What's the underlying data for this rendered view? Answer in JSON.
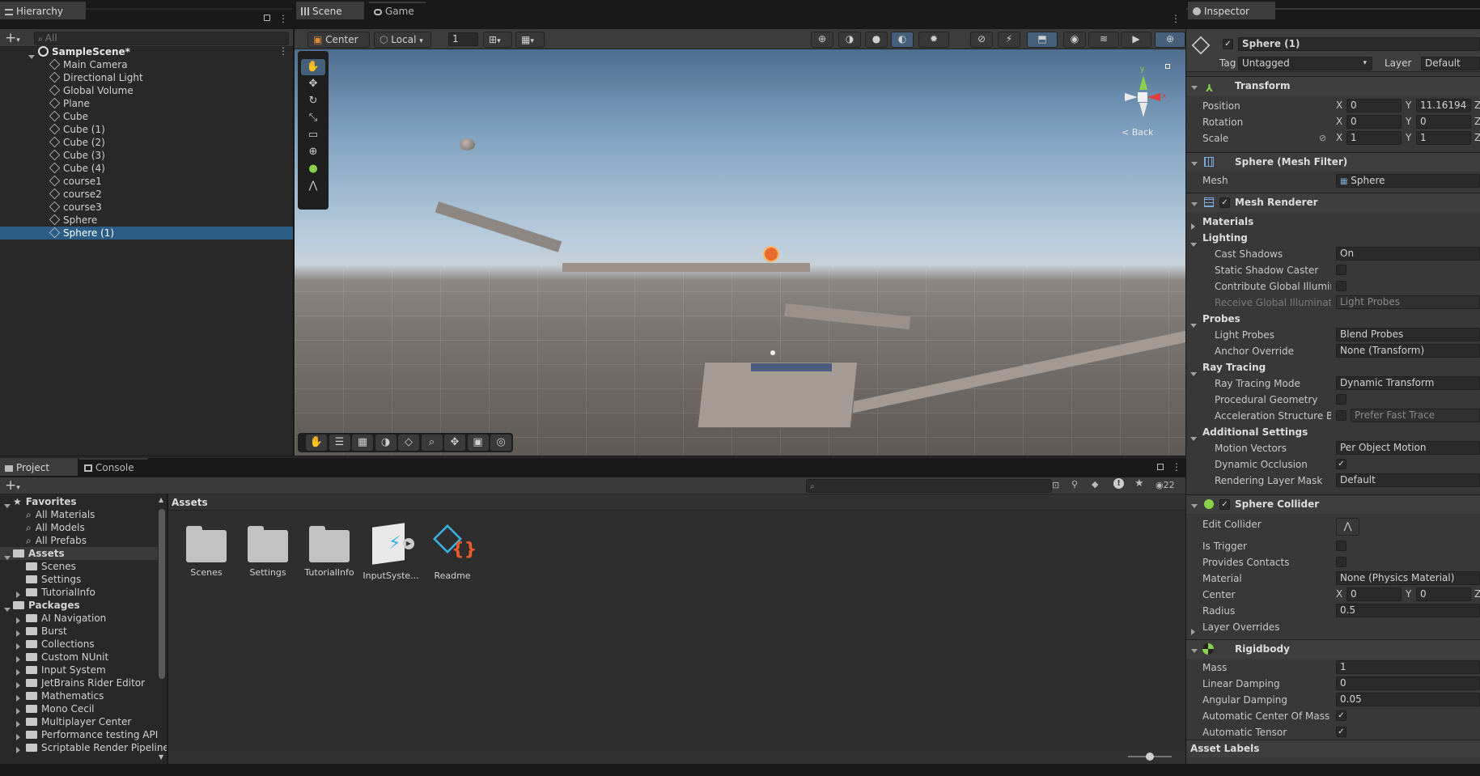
{
  "hierarchy": {
    "tab": "Hierarchy",
    "search_placeholder": "All",
    "scene_name": "SampleScene*",
    "items": [
      "Main Camera",
      "Directional Light",
      "Global Volume",
      "Plane",
      "Cube",
      "Cube (1)",
      "Cube (2)",
      "Cube (3)",
      "Cube (4)",
      "course1",
      "course2",
      "course3",
      "Sphere",
      "Sphere (1)"
    ],
    "selected": "Sphere (1)"
  },
  "scene": {
    "tabs": [
      "Scene",
      "Game"
    ],
    "pivot": "Center",
    "space": "Local",
    "grid_value": "1",
    "gizmo_back": "< Back"
  },
  "project": {
    "tabs": [
      "Project",
      "Console"
    ],
    "breadcrumb": "Assets",
    "hidden_count": "22",
    "favorites_label": "Favorites",
    "favorites": [
      "All Materials",
      "All Models",
      "All Prefabs"
    ],
    "assets_label": "Assets",
    "asset_folders": [
      "Scenes",
      "Settings",
      "TutorialInfo"
    ],
    "packages_label": "Packages",
    "packages": [
      "AI Navigation",
      "Burst",
      "Collections",
      "Custom NUnit",
      "Input System",
      "JetBrains Rider Editor",
      "Mathematics",
      "Mono Cecil",
      "Multiplayer Center",
      "Performance testing API",
      "Scriptable Render Pipeline"
    ],
    "tiles": [
      "Scenes",
      "Settings",
      "TutorialInfo",
      "InputSyste...",
      "Readme"
    ]
  },
  "inspector": {
    "tab": "Inspector",
    "object_name": "Sphere (1)",
    "tag_label": "Tag",
    "tag_value": "Untagged",
    "layer_label": "Layer",
    "layer_value": "Default",
    "transform": {
      "title": "Transform",
      "position_label": "Position",
      "pos_x": "0",
      "pos_y": "11.16194",
      "rotation_label": "Rotation",
      "rot_x": "0",
      "rot_y": "0",
      "scale_label": "Scale",
      "scale_x": "1",
      "scale_y": "1"
    },
    "mesh_filter": {
      "title": "Sphere (Mesh Filter)",
      "mesh_label": "Mesh",
      "mesh_value": "Sphere"
    },
    "mesh_renderer": {
      "title": "Mesh Renderer",
      "materials": "Materials",
      "lighting": "Lighting",
      "cast_shadows_label": "Cast Shadows",
      "cast_shadows_value": "On",
      "static_shadow_caster": "Static Shadow Caster",
      "contribute_gi": "Contribute Global Illuminat",
      "receive_gi_label": "Receive Global Illuminatior",
      "receive_gi_value": "Light Probes",
      "probes": "Probes",
      "light_probes_label": "Light Probes",
      "light_probes_value": "Blend Probes",
      "anchor_override_label": "Anchor Override",
      "anchor_override_value": "None (Transform)",
      "ray_tracing": "Ray Tracing",
      "ray_tracing_mode_label": "Ray Tracing Mode",
      "ray_tracing_mode_value": "Dynamic Transform",
      "procedural_geometry": "Procedural Geometry",
      "accel_structure_label": "Acceleration Structure Bui",
      "accel_structure_value": "Prefer Fast Trace",
      "additional_settings": "Additional Settings",
      "motion_vectors_label": "Motion Vectors",
      "motion_vectors_value": "Per Object Motion",
      "dynamic_occlusion": "Dynamic Occlusion",
      "rendering_layer_label": "Rendering Layer Mask",
      "rendering_layer_value": "Default"
    },
    "sphere_collider": {
      "title": "Sphere Collider",
      "edit_collider": "Edit Collider",
      "is_trigger": "Is Trigger",
      "provides_contacts": "Provides Contacts",
      "material_label": "Material",
      "material_value": "None (Physics Material)",
      "center_label": "Center",
      "center_x": "0",
      "center_y": "0",
      "radius_label": "Radius",
      "radius_value": "0.5",
      "layer_overrides": "Layer Overrides"
    },
    "rigidbody": {
      "title": "Rigidbody",
      "mass_label": "Mass",
      "mass_value": "1",
      "linear_damping_label": "Linear Damping",
      "linear_damping_value": "0",
      "angular_damping_label": "Angular Damping",
      "angular_damping_value": "0.05",
      "auto_com": "Automatic Center Of Mass",
      "auto_tensor": "Automatic Tensor"
    },
    "asset_labels": "Asset Labels",
    "axis": {
      "x": "X",
      "y": "Y",
      "z": "Z"
    }
  }
}
